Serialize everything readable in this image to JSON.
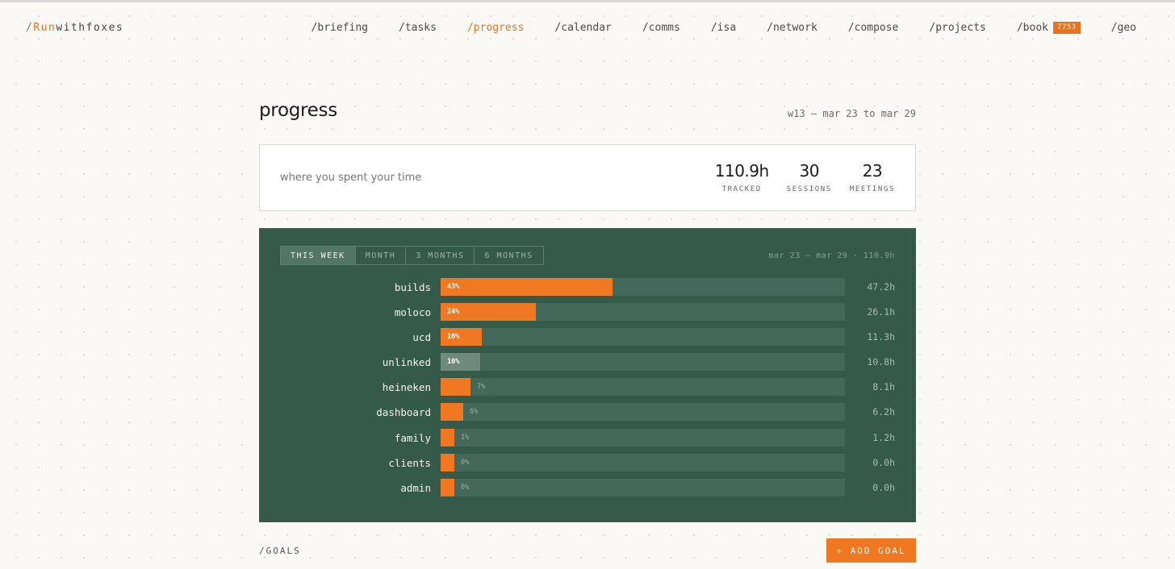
{
  "header": {
    "logo_slash": "/",
    "logo_accent": "Run",
    "logo_rest": "withfoxes",
    "nav": [
      {
        "label": "/briefing"
      },
      {
        "label": "/tasks"
      },
      {
        "label": "/progress",
        "active": true
      },
      {
        "label": "/calendar"
      },
      {
        "label": "/comms"
      },
      {
        "label": "/isa"
      },
      {
        "label": "/network"
      },
      {
        "label": "/compose"
      },
      {
        "label": "/projects"
      },
      {
        "label": "/book",
        "badge": "7753"
      },
      {
        "label": "/geo"
      }
    ]
  },
  "page": {
    "title": "progress",
    "week_range": "w13 — mar 23 to mar 29"
  },
  "summary": {
    "label": "where you spent your time",
    "stats": [
      {
        "value": "110.9h",
        "label": "TRACKED"
      },
      {
        "value": "30",
        "label": "SESSIONS"
      },
      {
        "value": "23",
        "label": "MEETINGS"
      }
    ]
  },
  "panel": {
    "tabs": [
      {
        "label": "THIS WEEK",
        "active": true
      },
      {
        "label": "MONTH"
      },
      {
        "label": "3 MONTHS"
      },
      {
        "label": "6 MONTHS"
      }
    ],
    "range": "mar 23 – mar 29 · 110.9h"
  },
  "chart_data": {
    "type": "bar",
    "orientation": "horizontal",
    "categories": [
      "builds",
      "moloco",
      "ucd",
      "unlinked",
      "heineken",
      "dashboard",
      "family",
      "clients",
      "admin"
    ],
    "values": [
      47.2,
      26.1,
      11.3,
      10.8,
      8.1,
      6.2,
      1.2,
      0.0,
      0.0
    ],
    "percent_labels": [
      "43%",
      "24%",
      "10%",
      "10%",
      "7%",
      "6%",
      "1%",
      "0%",
      "0%"
    ],
    "value_labels": [
      "47.2h",
      "26.1h",
      "11.3h",
      "10.8h",
      "8.1h",
      "6.2h",
      "1.2h",
      "0.0h",
      "0.0h"
    ],
    "highlight": [
      true,
      true,
      true,
      false,
      true,
      true,
      true,
      true,
      true
    ],
    "colors": {
      "accent": "#f07822",
      "muted": "#6e8a7d",
      "track": "#44695a",
      "panel": "#365a4a"
    }
  },
  "goals": {
    "title": "/GOALS",
    "add_label": "+ ADD GOAL"
  }
}
